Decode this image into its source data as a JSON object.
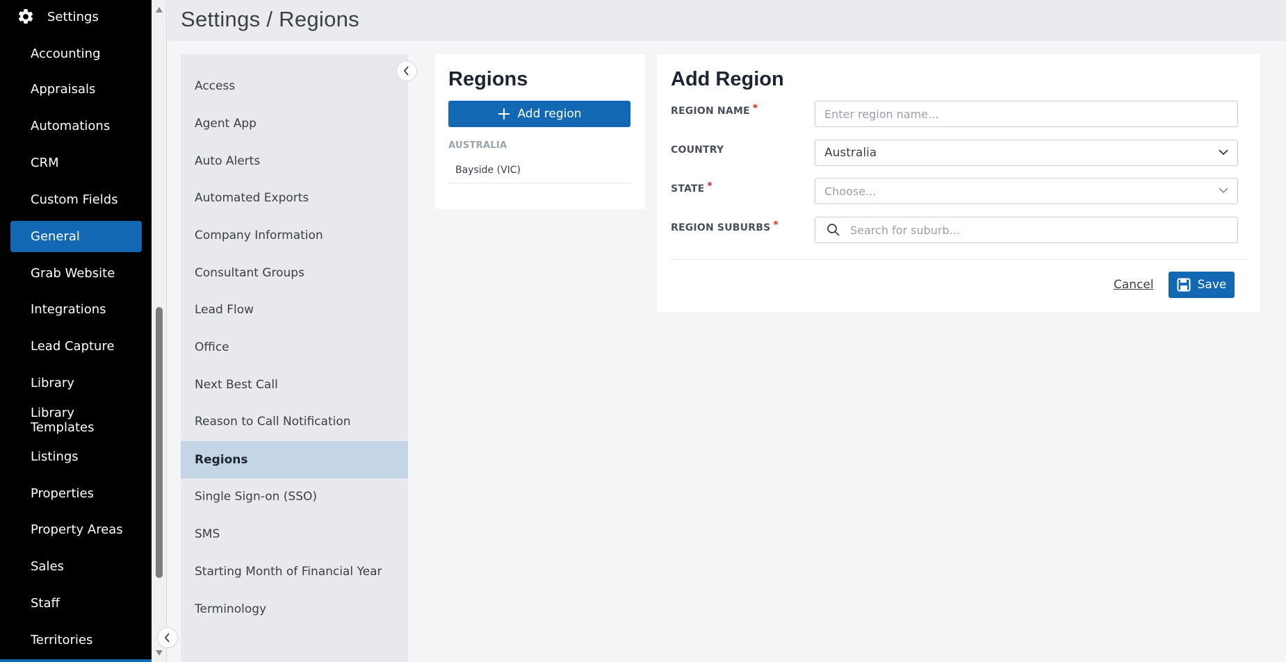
{
  "nav": {
    "header_label": "Settings",
    "header_icon": "gear-icon",
    "items": [
      {
        "label": "Accounting",
        "active": false
      },
      {
        "label": "Appraisals",
        "active": false
      },
      {
        "label": "Automations",
        "active": false
      },
      {
        "label": "CRM",
        "active": false
      },
      {
        "label": "Custom Fields",
        "active": false
      },
      {
        "label": "General",
        "active": true
      },
      {
        "label": "Grab Website",
        "active": false
      },
      {
        "label": "Integrations",
        "active": false
      },
      {
        "label": "Lead Capture",
        "active": false
      },
      {
        "label": "Library",
        "active": false
      },
      {
        "label": "Library Templates",
        "active": false
      },
      {
        "label": "Listings",
        "active": false
      },
      {
        "label": "Properties",
        "active": false
      },
      {
        "label": "Property Areas",
        "active": false
      },
      {
        "label": "Sales",
        "active": false
      },
      {
        "label": "Staff",
        "active": false
      },
      {
        "label": "Territories",
        "active": false
      }
    ]
  },
  "page": {
    "title": "Settings / Regions"
  },
  "submenu": {
    "items": [
      {
        "label": "Access",
        "active": false
      },
      {
        "label": "Agent App",
        "active": false
      },
      {
        "label": "Auto Alerts",
        "active": false
      },
      {
        "label": "Automated Exports",
        "active": false
      },
      {
        "label": "Company Information",
        "active": false
      },
      {
        "label": "Consultant Groups",
        "active": false
      },
      {
        "label": "Lead Flow",
        "active": false
      },
      {
        "label": "Office",
        "active": false
      },
      {
        "label": "Next Best Call",
        "active": false
      },
      {
        "label": "Reason to Call Notification",
        "active": false
      },
      {
        "label": "Regions",
        "active": true
      },
      {
        "label": "Single Sign-on (SSO)",
        "active": false
      },
      {
        "label": "SMS",
        "active": false
      },
      {
        "label": "Starting Month of Financial Year",
        "active": false
      },
      {
        "label": "Terminology",
        "active": false
      }
    ]
  },
  "regions": {
    "title": "Regions",
    "add_button_label": "Add region",
    "groups": [
      {
        "name": "AUSTRALIA",
        "regions": [
          "Bayside (VIC)"
        ]
      }
    ]
  },
  "form": {
    "title": "Add Region",
    "region_name": {
      "label": "REGION NAME",
      "required_mark": "*",
      "placeholder": "Enter region name...",
      "value": ""
    },
    "country": {
      "label": "COUNTRY",
      "value": "Australia"
    },
    "state": {
      "label": "STATE",
      "required_mark": "*",
      "placeholder": "Choose..."
    },
    "suburbs": {
      "label": "REGION SUBURBS",
      "required_mark": "*",
      "placeholder": "Search for suburb..."
    },
    "cancel_label": "Cancel",
    "save_label": "Save"
  },
  "colors": {
    "accent": "#1268b3",
    "nav_bg": "#000000",
    "submenu_active_bg": "#c4d6e5",
    "required": "#e02424"
  }
}
